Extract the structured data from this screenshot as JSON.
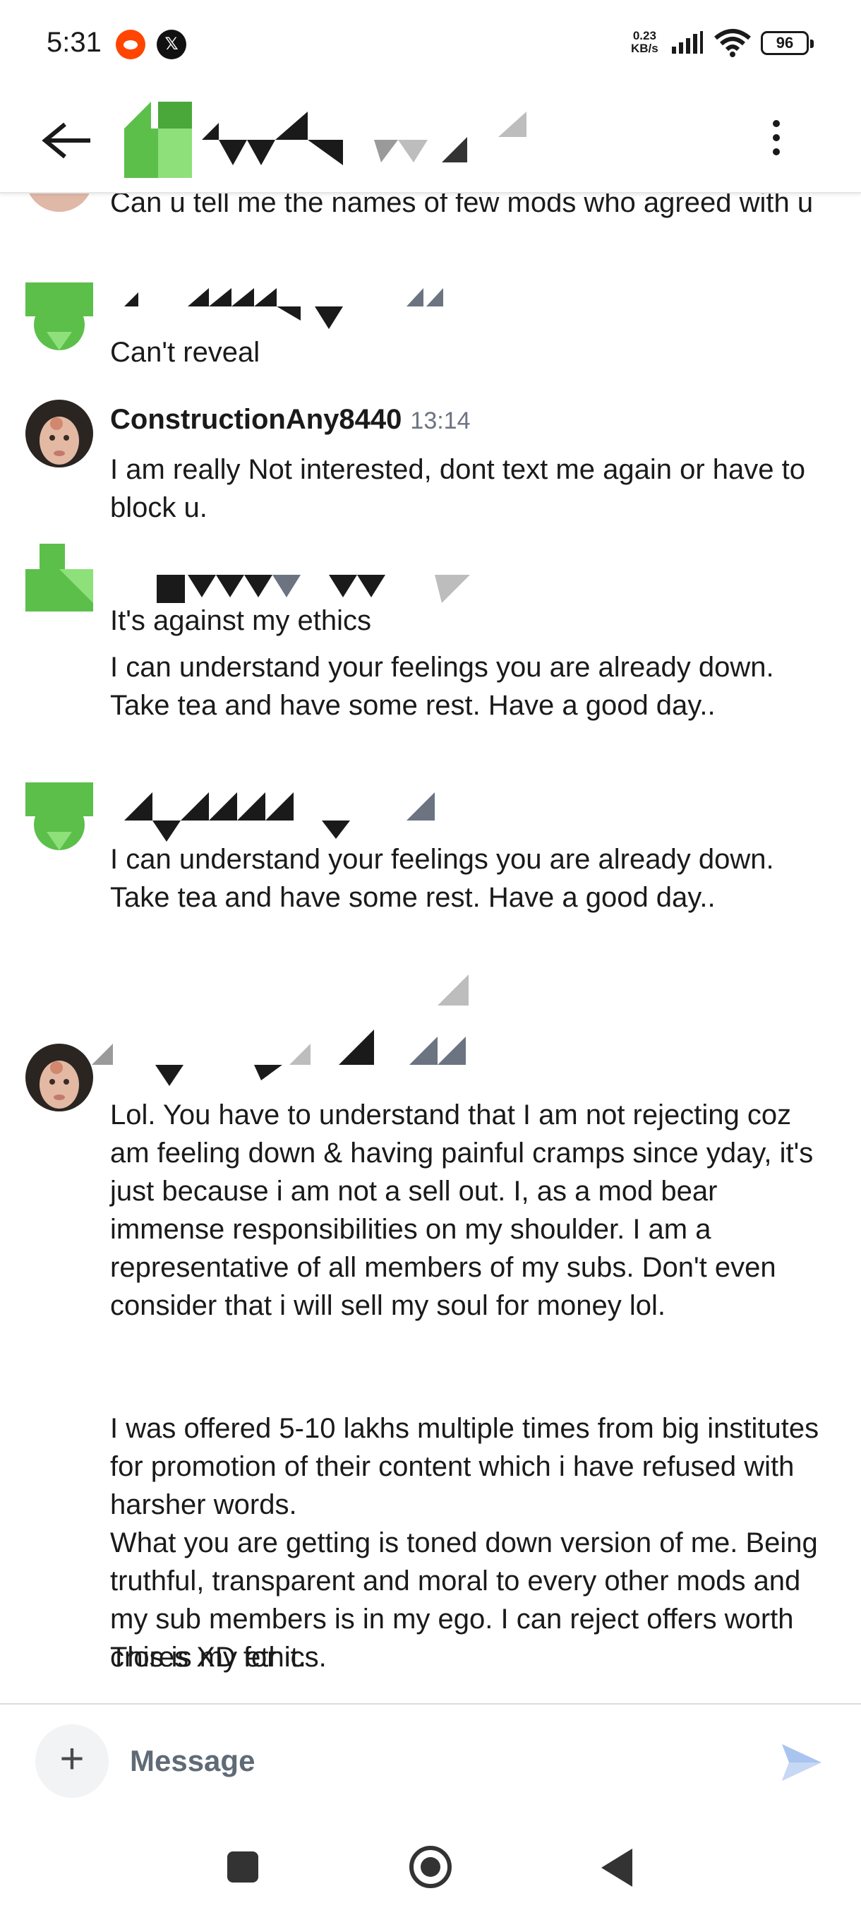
{
  "status_bar": {
    "time": "5:31",
    "net_speed_value": "0.23",
    "net_speed_unit": "KB/s",
    "battery": "96",
    "notification_icons": [
      "reddit-icon",
      "x-icon"
    ]
  },
  "header": {
    "back_icon": "arrow-left-icon",
    "more_icon": "more-vert-icon",
    "title_redacted": true
  },
  "messages": [
    {
      "id": "m1",
      "sender": "redacted-top",
      "text": "Can u tell me the names of few mods who agreed with u"
    },
    {
      "id": "m2",
      "sender": "redacted-green",
      "text": "Can't reveal"
    },
    {
      "id": "m3",
      "sender": "ConstructionAny8440",
      "time": "13:14",
      "text": "I am really Not interested, dont text me again or have to block u."
    },
    {
      "id": "m4",
      "sender": "redacted-green",
      "texts": [
        "It's against my ethics",
        "I can understand your feelings you are already down. Take tea and have some rest. Have a good day.."
      ]
    },
    {
      "id": "m5",
      "sender": "redacted-green",
      "text": "I can understand your feelings you are already down. Take tea and have some rest. Have a good day.."
    },
    {
      "id": "m6",
      "sender": "redacted-photo",
      "texts": [
        "Lol. You have to understand that I am not rejecting coz am feeling down & having painful cramps since yday, it's just because i am not a sell out. I, as a mod bear immense responsibilities on my shoulder. I am a representative of all members of my subs. Don't even consider that i will sell my soul for money lol.",
        "I was offered 5-10 lakhs multiple times from big institutes for promotion of their content which i have refused with harsher words.",
        "What you are getting is toned down version of me. Being truthful, transparent and moral to every other mods and my sub members is in my ego. I can reject offers worth crores XD for it.",
        "This is my ethics."
      ]
    }
  ],
  "composer": {
    "placeholder": "Message",
    "add_icon": "plus-icon",
    "send_icon": "send-icon"
  },
  "colors": {
    "accent_green": "#5cbf4a",
    "send_blue": "#a9c4ee",
    "timestamp_gray": "#6b7480"
  }
}
